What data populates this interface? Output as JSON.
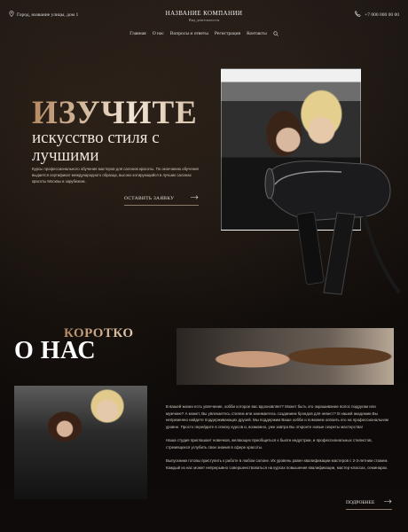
{
  "header": {
    "address": "Город, название улицы, дом 1",
    "company_name": "НАЗВАНИЕ КОМПАНИИ",
    "company_sub": "Вид деятельности",
    "phone": "+7 000 000 00 00"
  },
  "nav": {
    "items": [
      "Главная",
      "О нас",
      "Вопросы и ответы",
      "Регистрация",
      "Контакты"
    ]
  },
  "hero": {
    "title": "ИЗУЧИТЕ",
    "subtitle": "искусство стиля с лучшими",
    "description": "Курсы профессионального обучения мастеров для салонов красоты. По окончанию обучения выдается сертификат международного образца, высоко котирующийся в лучших салонах красоты Москвы и зарубежом.",
    "cta_label": "ОСТАВИТЬ ЗАЯВКУ"
  },
  "about": {
    "title_small": "КОРОТКО",
    "title_big": "О НАС",
    "paragraphs": [
      "В вашей жизни есть увлечение, хобби которое вас вдохновляет? Может быть это окрашивание волос подругам или мужчине? А может, Вы увлекаетесь стилем или занимаетесь созданием брэндов для невест? В нашей академии Вы непременно найдете поддерживающих друзей. Мы поддержим Ваше хобби и поможем освоить его на профессиональном уровне. Просто перейдите в списку курсов и, возможно, уже завтра Вы откроете новые секреты мастерства!",
      "Наша студия приглашает новичков, желающих приобщиться к бьюти индустрии, и профессиональных стилистов, стремящихся углубить свои знания в сфере красоты.",
      "Выпускники готовы приступить к работе в любом салоне. Их уровень равен квалификации мастеров с 2-3-летним стажем. Каждый из нас может непрерывно совершенствоваться на курсах повышения квалификации, мастер-классах, семинарах."
    ],
    "more_label": "ПОДРОБНЕЕ"
  }
}
